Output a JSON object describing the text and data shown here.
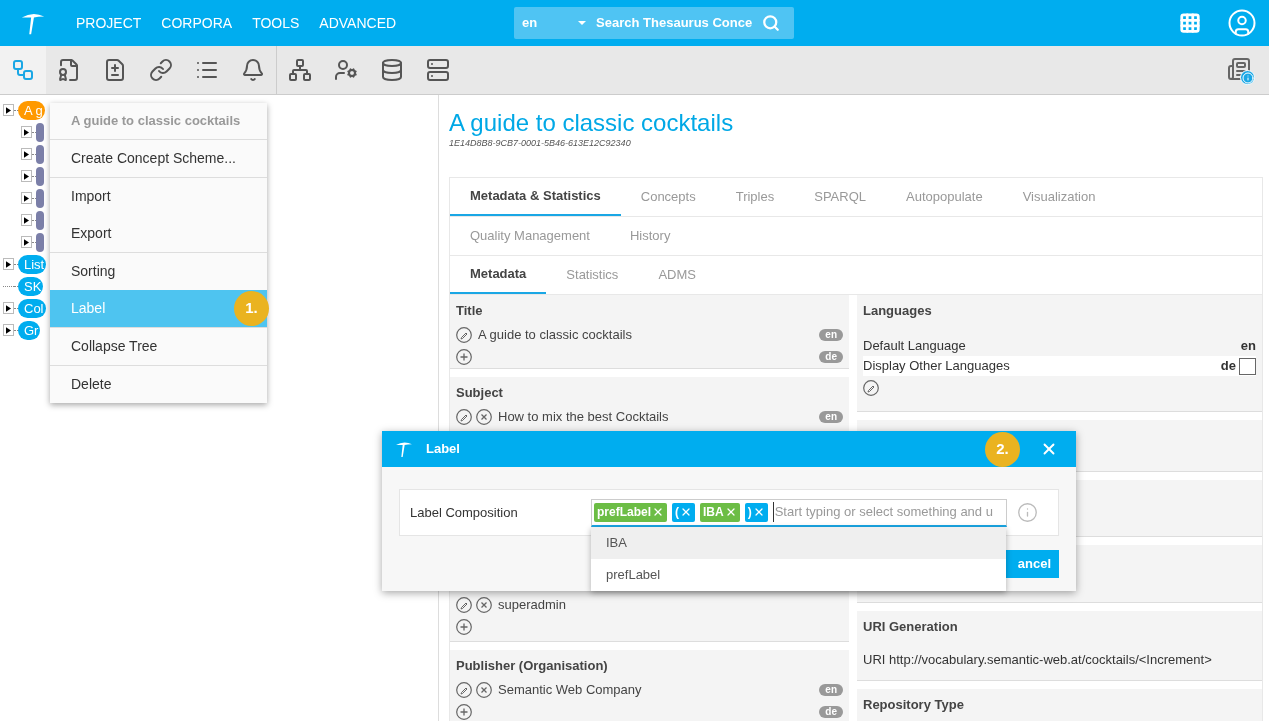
{
  "nav": {
    "items": [
      "PROJECT",
      "CORPORA",
      "TOOLS",
      "ADVANCED"
    ],
    "search": {
      "language": "en",
      "placeholder": "Search Thesaurus Conce"
    }
  },
  "toolbar": [
    {
      "kind": "tree",
      "selected": true
    },
    {
      "kind": "document",
      "selected": false
    },
    {
      "kind": "labels",
      "selected": false
    },
    {
      "kind": "link",
      "selected": false
    },
    {
      "kind": "list",
      "selected": false
    },
    {
      "kind": "bell",
      "selected": false
    },
    {
      "kind": "hierarchy",
      "selected": false
    },
    {
      "kind": "user-settings",
      "selected": false
    },
    {
      "kind": "database",
      "selected": false
    },
    {
      "kind": "server",
      "selected": false
    }
  ],
  "tree": [
    {
      "label": "A g",
      "color": "#ff9900",
      "expandable": true,
      "children": [
        {
          "color": "#7b7fa8",
          "expandable": true
        },
        {
          "color": "#7b7fa8",
          "expandable": true
        },
        {
          "color": "#7b7fa8",
          "expandable": true
        },
        {
          "color": "#7b7fa8",
          "expandable": true
        },
        {
          "color": "#7b7fa8",
          "expandable": true
        },
        {
          "color": "#7b7fa8",
          "expandable": true
        }
      ]
    },
    {
      "label": "List",
      "color": "#00adef",
      "expandable": true
    },
    {
      "label": "SK",
      "color": "#00adef",
      "expandable": false
    },
    {
      "label": "Col",
      "color": "#00adef",
      "expandable": true
    },
    {
      "label": "Gr",
      "color": "#00adef",
      "expandable": true
    }
  ],
  "context_menu": {
    "title": "A guide to classic cocktails",
    "groups": [
      [
        {
          "label": "Create Concept Scheme...",
          "selected": false
        }
      ],
      [
        {
          "label": "Import",
          "selected": false
        },
        {
          "label": "Export",
          "selected": false
        }
      ],
      [
        {
          "label": "Sorting",
          "selected": false
        },
        {
          "label": "Label",
          "selected": true,
          "callout": "1."
        }
      ],
      [
        {
          "label": "Collapse Tree",
          "selected": false
        }
      ],
      [
        {
          "label": "Delete",
          "selected": false
        }
      ]
    ]
  },
  "detail": {
    "title": "A guide to classic cocktails",
    "id": "1E14D8B8-9CB7-0001-5B46-613E12C92340",
    "tabs": [
      [
        {
          "label": "Metadata & Statistics",
          "selected": true
        },
        {
          "label": "Concepts",
          "selected": false
        },
        {
          "label": "Triples",
          "selected": false
        },
        {
          "label": "SPARQL",
          "selected": false
        },
        {
          "label": "Autopopulate",
          "selected": false
        },
        {
          "label": "Visualization",
          "selected": false
        }
      ],
      [
        {
          "label": "Quality Management",
          "selected": false
        },
        {
          "label": "History",
          "selected": false
        }
      ]
    ],
    "subtabs": [
      {
        "label": "Metadata",
        "selected": true
      },
      {
        "label": "Statistics",
        "selected": false
      },
      {
        "label": "ADMS",
        "selected": false
      }
    ],
    "left_cards": [
      {
        "title": "Title",
        "rows": [
          {
            "kind": "value",
            "editable": true,
            "removable": false,
            "text": "A guide to classic cocktails",
            "lang": "en"
          },
          {
            "kind": "add",
            "lang": "de"
          }
        ]
      },
      {
        "title": "Subject",
        "rows": [
          {
            "kind": "value",
            "editable": true,
            "removable": true,
            "text": "How to mix the best Cocktails",
            "lang": "en"
          }
        ]
      },
      {
        "rows": [
          {
            "kind": "value",
            "editable": true,
            "removable": true,
            "text": "superadmin"
          },
          {
            "kind": "add"
          }
        ]
      },
      {
        "title": "Publisher (Organisation)",
        "rows": [
          {
            "kind": "value",
            "editable": true,
            "removable": true,
            "text": "Semantic Web Company",
            "lang": "en"
          },
          {
            "kind": "add",
            "lang": "de"
          }
        ]
      }
    ],
    "languages": {
      "title": "Languages",
      "default_label": "Default Language",
      "default_value": "en",
      "other_label": "Display Other Languages",
      "other_value": "de",
      "other_checked": false
    },
    "uri_generation": {
      "title": "URI Generation",
      "text": "URI http://vocabulary.semantic-web.at/cocktails/<Increment>"
    },
    "repository_type": {
      "title": "Repository Type"
    }
  },
  "dialog": {
    "title": "Label",
    "callout": "2.",
    "field_label": "Label Composition",
    "chips": [
      {
        "label": "prefLabel",
        "color": "#6cbd45"
      },
      {
        "label": "(",
        "color": "#00adef"
      },
      {
        "label": "IBA",
        "color": "#6cbd45"
      },
      {
        "label": ")",
        "color": "#00adef"
      }
    ],
    "placeholder": "Start typing or select something and u",
    "suggestions": [
      {
        "label": "IBA",
        "selected": true
      },
      {
        "label": "prefLabel",
        "selected": false
      }
    ],
    "cancel": "ancel"
  }
}
